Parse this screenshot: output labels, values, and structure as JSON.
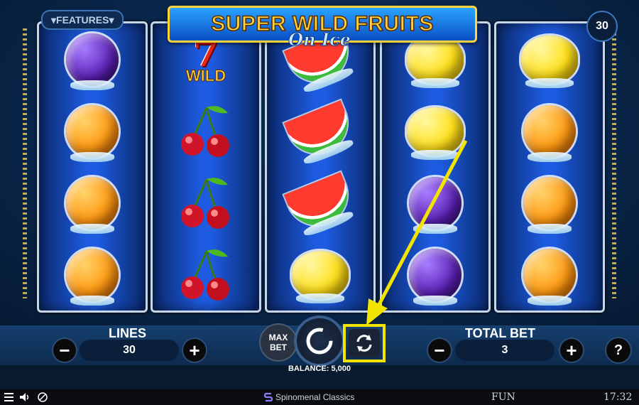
{
  "game": {
    "title": "SUPER WILD FRUITS",
    "subtitle": "On Ice",
    "features_label": "FEATURES",
    "active_lines_badge": "30"
  },
  "reels": [
    [
      "plum",
      "orange",
      "orange",
      "orange"
    ],
    [
      "wild",
      "cherry",
      "cherry",
      "cherry"
    ],
    [
      "watermelon",
      "watermelon",
      "watermelon",
      "lemon"
    ],
    [
      "lemon",
      "lemon",
      "plum",
      "plum"
    ],
    [
      "lemon",
      "orange",
      "orange",
      "orange"
    ]
  ],
  "wild_symbol": {
    "digit": "7",
    "text": "WILD"
  },
  "controls": {
    "lines_label": "LINES",
    "lines_value": "30",
    "max_bet_label": "MAX BET",
    "total_bet_label": "TOTAL BET",
    "total_bet_value": "3",
    "minus": "−",
    "plus": "+",
    "help": "?",
    "balance": "BALANCE: 5,000"
  },
  "footer": {
    "brand": "Spinomenal Classics",
    "mode": "FUN",
    "clock": "17:32"
  },
  "annotation": {
    "color": "#f2e400"
  }
}
